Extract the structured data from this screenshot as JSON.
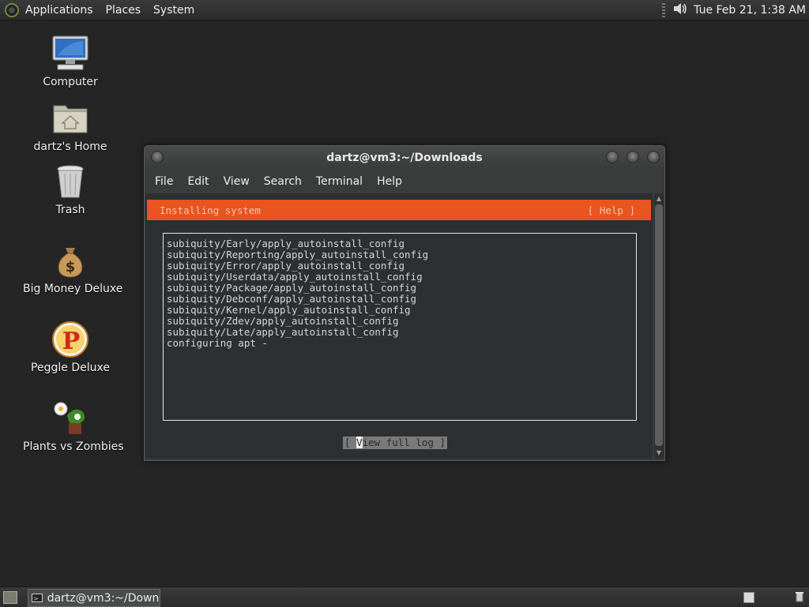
{
  "top_panel": {
    "menus": [
      "Applications",
      "Places",
      "System"
    ],
    "clock": "Tue Feb 21,  1:38 AM",
    "volume_icon": "speaker-icon"
  },
  "desktop_icons": [
    {
      "label": "Computer",
      "icon": "computer-icon"
    },
    {
      "label": "dartz's Home",
      "icon": "home-folder-icon"
    },
    {
      "label": "Trash",
      "icon": "trash-icon"
    },
    {
      "label": "Big Money Deluxe",
      "icon": "money-bag-icon"
    },
    {
      "label": "Peggle Deluxe",
      "icon": "peggle-icon"
    },
    {
      "label": "Plants vs Zombies",
      "icon": "plants-vs-zombies-icon"
    }
  ],
  "terminal": {
    "title": "dartz@vm3:~/Downloads",
    "menus": [
      "File",
      "Edit",
      "View",
      "Search",
      "Terminal",
      "Help"
    ],
    "header_title": "Installing system",
    "header_help": "[ Help ]",
    "log_lines": [
      "subiquity/Early/apply_autoinstall_config",
      "subiquity/Reporting/apply_autoinstall_config",
      "subiquity/Error/apply_autoinstall_config",
      "subiquity/Userdata/apply_autoinstall_config",
      "subiquity/Package/apply_autoinstall_config",
      "subiquity/Debconf/apply_autoinstall_config",
      "subiquity/Kernel/apply_autoinstall_config",
      "subiquity/Zdev/apply_autoinstall_config",
      "subiquity/Late/apply_autoinstall_config",
      "configuring apt -"
    ],
    "view_log_prefix": "[ ",
    "view_log_cursor": "V",
    "view_log_rest": "iew full log ]"
  },
  "bottom_panel": {
    "task_label": "dartz@vm3:~/Down..."
  },
  "colors": {
    "accent": "#e95420",
    "desktop": "#252525"
  }
}
